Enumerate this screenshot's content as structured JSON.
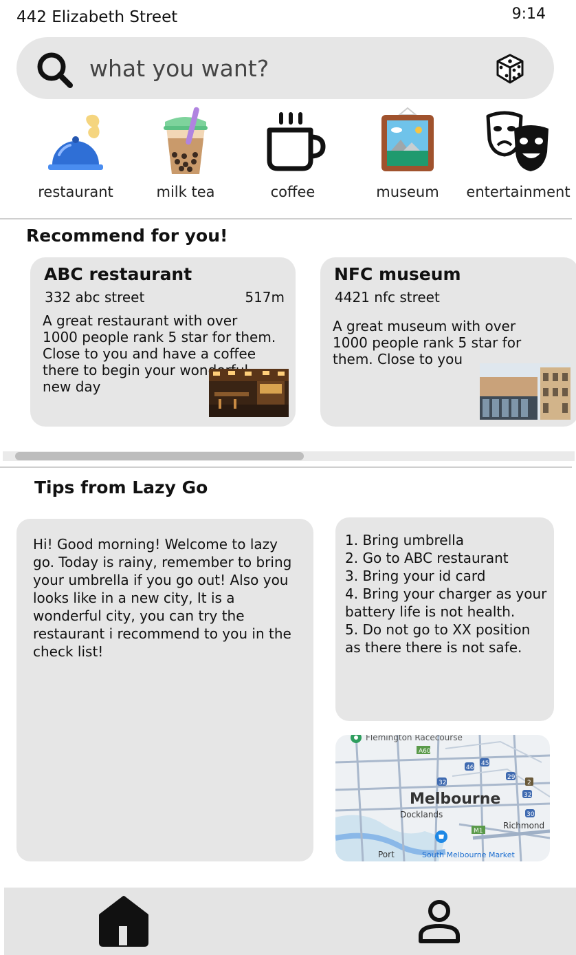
{
  "status_bar": {
    "location": "442 Elizabeth Street",
    "time": "9:14"
  },
  "search": {
    "placeholder": "what you want?"
  },
  "categories": [
    {
      "label": "restaurant",
      "icon": "food-cloche-icon"
    },
    {
      "label": "milk tea",
      "icon": "bubble-tea-icon"
    },
    {
      "label": "coffee",
      "icon": "coffee-cup-icon"
    },
    {
      "label": "museum",
      "icon": "framed-picture-icon"
    },
    {
      "label": "entertainment",
      "icon": "theater-masks-icon"
    }
  ],
  "recommend": {
    "title": "Recommend for you!",
    "cards": [
      {
        "name": "ABC restaurant",
        "address": "332 abc street",
        "distance": "517m",
        "description": "A great restaurant with over 1000 people rank 5 star for them. Close to you and have a coffee there to begin your wonderful new day"
      },
      {
        "name": "NFC museum",
        "address": "4421 nfc street",
        "description": "A great museum with over 1000 people rank 5 star for them. Close to you"
      }
    ]
  },
  "tips": {
    "title": "Tips from Lazy Go",
    "message": "Hi! Good morning! Welcome to lazy go.  Today is rainy, remember to bring your umbrella if you go out! Also you looks like in a new city, It is a wonderful city, you can try the restaurant i recommend to you in the check list!",
    "checklist": [
      "1. Bring umbrella",
      "2. Go to ABC restaurant",
      "3. Bring your id card",
      "4. Bring your charger as your battery life is not health.",
      "5. Do not go to XX position as there there is not safe."
    ]
  },
  "map": {
    "labels": {
      "racecourse": "Flemington Racecourse",
      "city": "Melbourne",
      "docklands": "Docklands",
      "richmond": "Richmond",
      "market": "South Melbourne Market",
      "port": "Port",
      "a60": "A60",
      "m1": "M1",
      "r46": "46",
      "r45": "45",
      "r32a": "32",
      "r29": "29",
      "r2": "2",
      "r32b": "32",
      "r30": "30"
    }
  },
  "nav": {
    "home_icon": "home-icon",
    "profile_icon": "user-profile-icon"
  },
  "colors": {
    "panel_gray": "#e6e6e6",
    "cloche_blue": "#2f6fd6",
    "boba_brown": "#b98a5e"
  }
}
